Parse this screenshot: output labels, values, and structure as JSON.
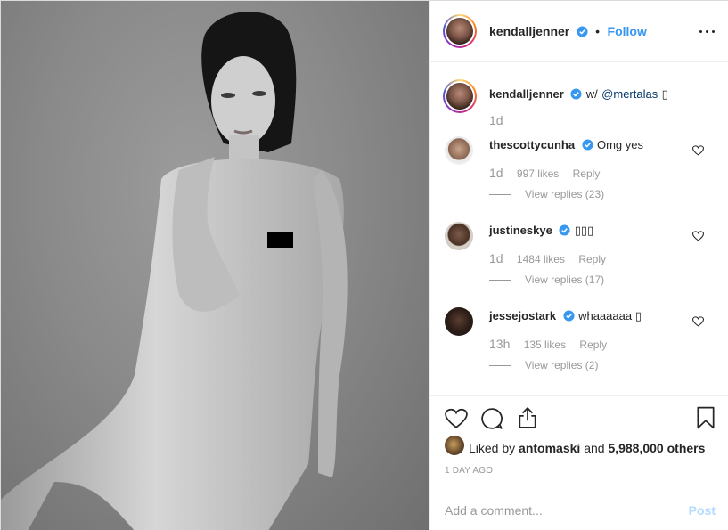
{
  "post": {
    "author": "kendalljenner",
    "follow_label": "Follow",
    "separator": "•",
    "caption_text": "w/",
    "caption_mention": "@mertalas",
    "caption_emoji": "▯",
    "caption_time": "1d"
  },
  "comments": [
    {
      "user": "thescottycunha",
      "text": "Omg yes",
      "time": "1d",
      "likes": "997 likes",
      "reply_label": "Reply",
      "view_replies": "View replies (23)"
    },
    {
      "user": "justineskye",
      "text": "▯▯▯",
      "time": "1d",
      "likes": "1484 likes",
      "reply_label": "Reply",
      "view_replies": "View replies (17)"
    },
    {
      "user": "jessejostark",
      "text": "whaaaaaa ▯",
      "time": "13h",
      "likes": "135 likes",
      "reply_label": "Reply",
      "view_replies": "View replies (2)"
    }
  ],
  "actions": {
    "liked_by_prefix": "Liked by",
    "liked_by_user": "antomaski",
    "liked_by_and": "and",
    "liked_by_count": "5,988,000 others",
    "date": "1 DAY AGO"
  },
  "composer": {
    "placeholder": "Add a comment...",
    "post_label": "Post"
  },
  "icons": {
    "verified": "verified-badge-icon",
    "more": "more-options-icon",
    "like": "heart-icon",
    "comment": "comment-icon",
    "share": "share-icon",
    "save": "bookmark-icon"
  },
  "colors": {
    "accent": "#3897f0",
    "text": "#262626",
    "muted": "#999999",
    "mention": "#003569",
    "post_disabled": "#b3dbff"
  }
}
